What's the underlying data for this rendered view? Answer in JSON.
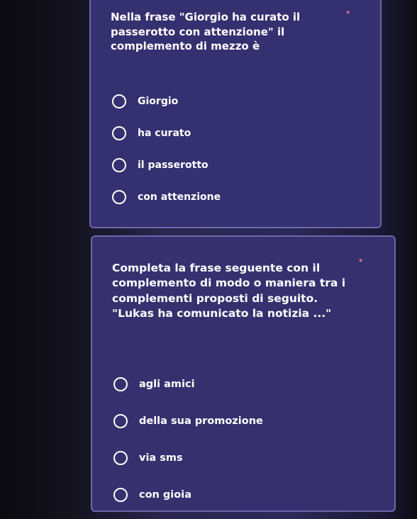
{
  "questions": [
    {
      "text": "Nella frase \"Giorgio ha curato il\npasserotto con attenzione\" il\ncomplemento di mezzo è",
      "required_mark": "*",
      "options": [
        "Giorgio",
        "ha curato",
        "il passerotto",
        "con attenzione"
      ]
    },
    {
      "text": "Completa la frase seguente con il\ncomplemento di modo o maniera tra i\ncomplementi proposti di seguito.\n\"Lukas ha comunicato la notizia ...\"",
      "required_mark": "*",
      "options": [
        "agli amici",
        "della sua promozione",
        "via sms",
        "con gioia"
      ]
    }
  ],
  "colors": {
    "card_background": "#342f6a",
    "card_border": "#6e67a8",
    "text": "#ffffff",
    "required_mark": "#ff7a9a"
  }
}
